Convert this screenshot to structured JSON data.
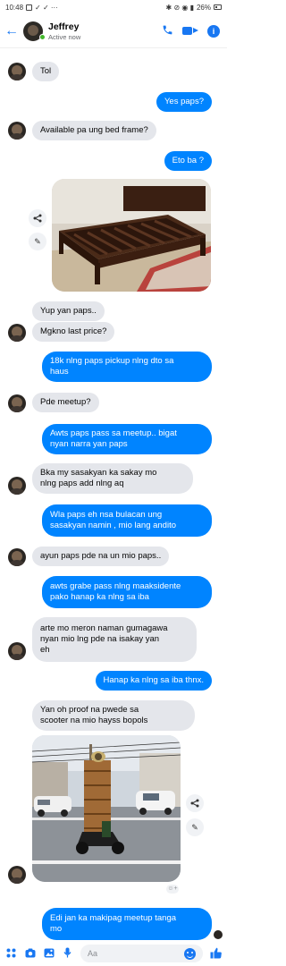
{
  "status_bar": {
    "time": "10:48",
    "battery": "26%"
  },
  "header": {
    "back_icon": "back-arrow-icon",
    "name": "Jeffrey",
    "status": "Active now",
    "icons": [
      "phone-icon",
      "video-icon",
      "info-icon"
    ],
    "accent": "#1877f2"
  },
  "messages": [
    {
      "dir": "in",
      "text": "Tol"
    },
    {
      "dir": "out",
      "text": "Yes paps?"
    },
    {
      "dir": "in",
      "text": "Available pa ung bed frame?"
    },
    {
      "dir": "out",
      "text": "Eto ba ?"
    },
    {
      "dir": "in",
      "text": "Yup yan paps.."
    },
    {
      "dir": "in",
      "text": "Mgkno last price?"
    },
    {
      "dir": "out",
      "line1": "18k nlng paps pickup nlng dto sa",
      "line2": "haus"
    },
    {
      "dir": "in",
      "text": "Pde meetup?"
    },
    {
      "dir": "out",
      "line1": "Awts paps pass sa meetup.. bigat",
      "line2": "nyan narra yan paps"
    },
    {
      "dir": "in",
      "line1": "Bka my sasakyan ka sakay mo",
      "line2": "nlng paps add nlng aq"
    },
    {
      "dir": "out",
      "line1": "Wla paps eh nsa bulacan ung",
      "line2": "sasakyan namin , mio lang andito"
    },
    {
      "dir": "in",
      "text": "ayun paps pde na un mio paps.."
    },
    {
      "dir": "out",
      "line1": "awts grabe pass nlng maaksidente",
      "line2": "pako hanap ka nlng sa iba"
    },
    {
      "dir": "in",
      "line1": "arte mo meron naman gumagawa",
      "line2": "nyan mio lng pde na isakay yan",
      "line3": "eh"
    },
    {
      "dir": "out",
      "text": "Hanap ka nlng sa iba thnx."
    },
    {
      "dir": "in",
      "line1": "Yan oh proof na pwede sa",
      "line2": "scooter na mio hayss bopols"
    },
    {
      "dir": "out",
      "line1": "Edi jan ka makipag meetup tanga",
      "line2": "mo"
    }
  ],
  "photo_actions": [
    "share-icon",
    "edit-icon"
  ],
  "composer": {
    "placeholder": "Aa",
    "icons": [
      "apps-icon",
      "camera-icon",
      "gallery-icon",
      "mic-icon",
      "emoji-icon",
      "thumbs-up-icon"
    ]
  },
  "colors": {
    "outgoing_bubble": "#0084ff",
    "incoming_bubble": "#e4e6eb"
  }
}
